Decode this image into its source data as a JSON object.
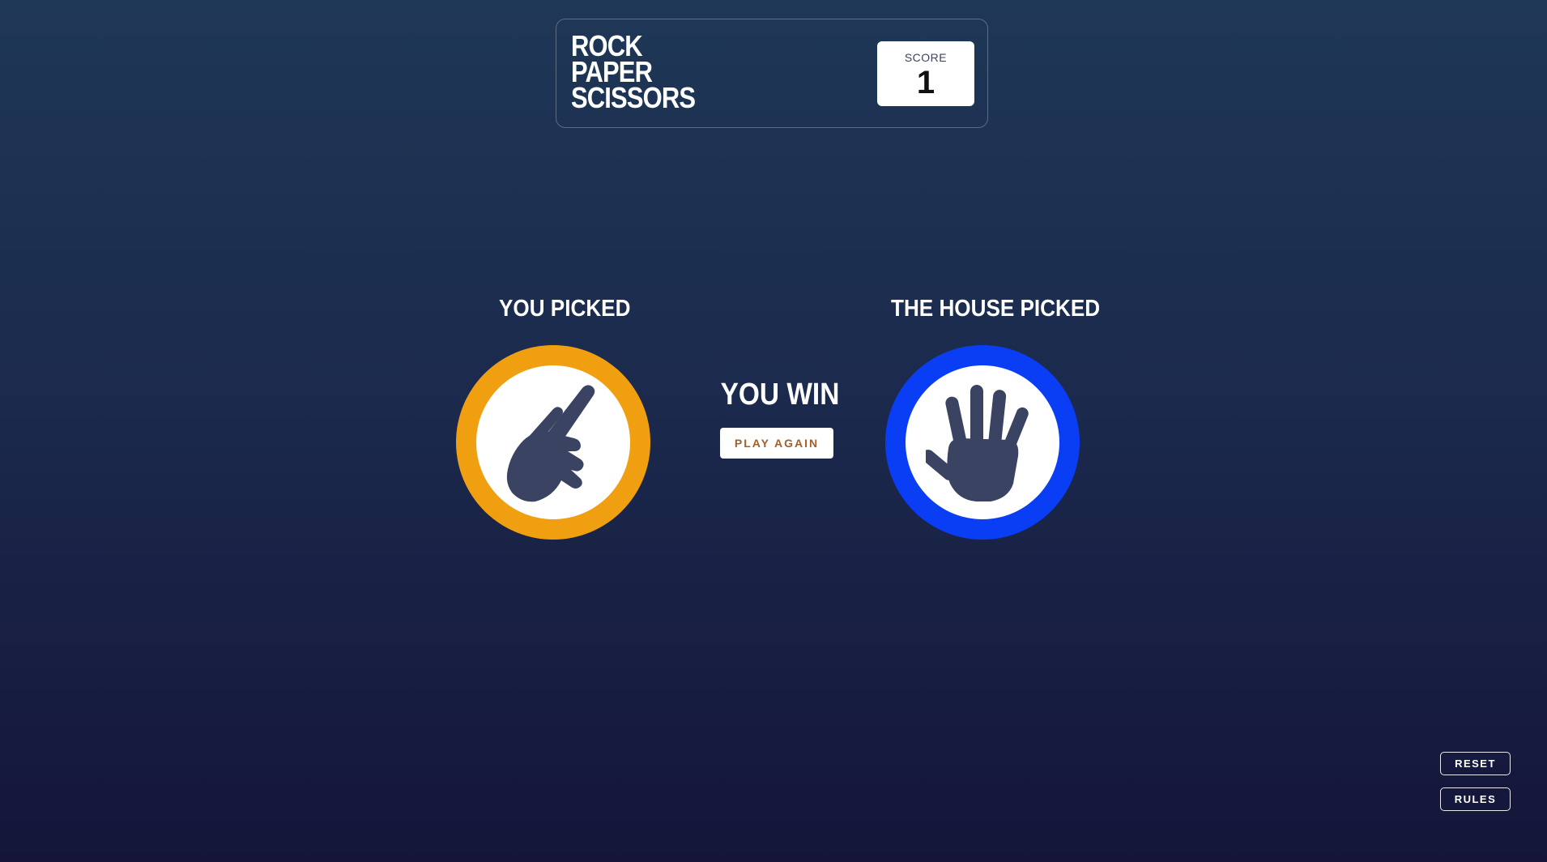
{
  "header": {
    "title_lines": [
      "ROCK",
      "PAPER",
      "SCISSORS"
    ],
    "score_label": "SCORE",
    "score_value": "1"
  },
  "player": {
    "label": "YOU PICKED",
    "choice": "scissors",
    "icon": "scissors-hand-icon",
    "ring_color": "#f09f10"
  },
  "house": {
    "label": "THE HOUSE PICKED",
    "choice": "paper",
    "icon": "paper-hand-icon",
    "ring_color": "#0a3ef5"
  },
  "result": {
    "text": "YOU WIN",
    "play_again_label": "PLAY AGAIN"
  },
  "controls": {
    "reset_label": "RESET",
    "rules_label": "RULES"
  },
  "colors": {
    "background_top": "#1f3756",
    "background_bottom": "#141539",
    "icon_fill": "#3b4363",
    "play_again_text": "#a35e2b"
  }
}
